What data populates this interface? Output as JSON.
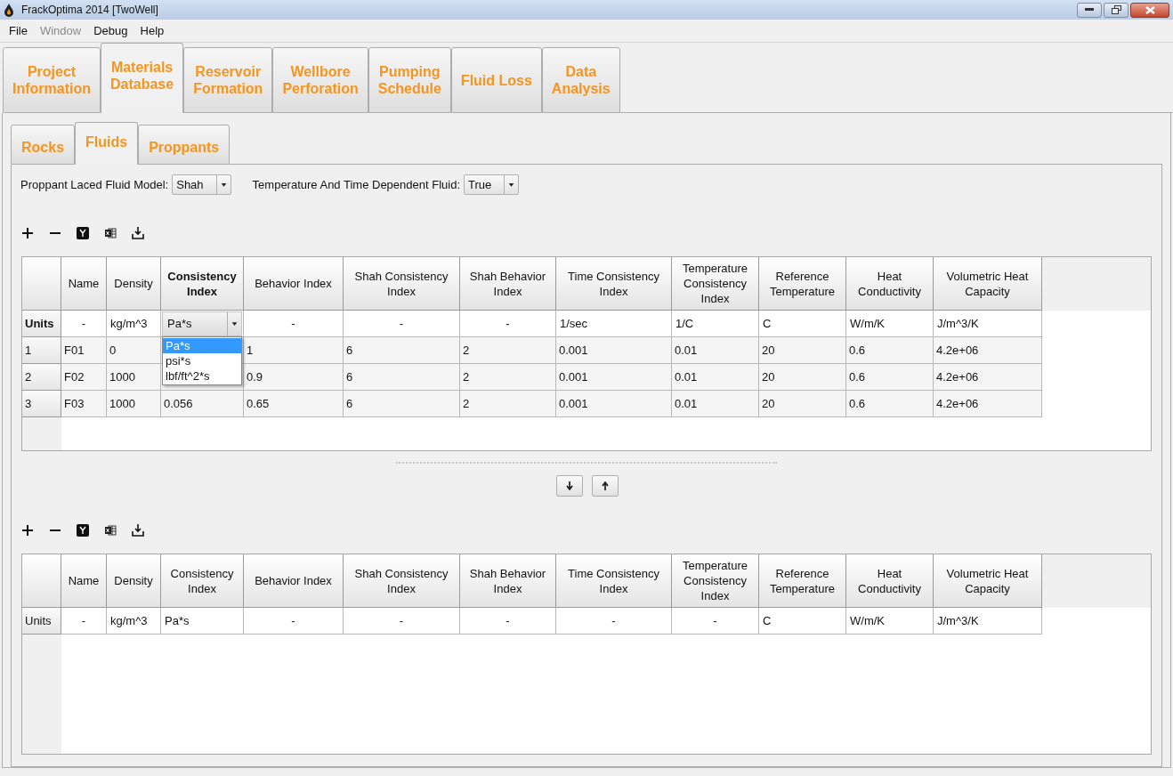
{
  "window": {
    "title": "FrackOptima 2014 [TwoWell]"
  },
  "menu": [
    {
      "label": "File",
      "disabled": false
    },
    {
      "label": "Window",
      "disabled": true
    },
    {
      "label": "Debug",
      "disabled": false
    },
    {
      "label": "Help",
      "disabled": false
    }
  ],
  "main_tabs": [
    {
      "label": "Project\nInformation",
      "selected": false
    },
    {
      "label": "Materials\nDatabase",
      "selected": true
    },
    {
      "label": "Reservoir\nFormation",
      "selected": false
    },
    {
      "label": "Wellbore\nPerforation",
      "selected": false
    },
    {
      "label": "Pumping\nSchedule",
      "selected": false
    },
    {
      "label": "Fluid Loss",
      "selected": false
    },
    {
      "label": "Data\nAnalysis",
      "selected": false
    }
  ],
  "sub_tabs": [
    {
      "label": "Rocks",
      "selected": false
    },
    {
      "label": "Fluids",
      "selected": true
    },
    {
      "label": "Proppants",
      "selected": false
    }
  ],
  "settings": [
    {
      "label": "Proppant Laced Fluid Model:",
      "value": "Shah"
    },
    {
      "label": "Temperature And Time Dependent Fluid:",
      "value": "True"
    }
  ],
  "tables": [
    {
      "columns": [
        {
          "label": "Name",
          "selected": false
        },
        {
          "label": "Density",
          "selected": false
        },
        {
          "label": "Consistency Index",
          "selected": true
        },
        {
          "label": "Behavior Index",
          "selected": false
        },
        {
          "label": "Shah Consistency Index",
          "selected": false
        },
        {
          "label": "Shah Behavior Index",
          "selected": false
        },
        {
          "label": "Time Consistency Index",
          "selected": false
        },
        {
          "label": "Temperature Consistency Index",
          "selected": false
        },
        {
          "label": "Reference Temperature",
          "selected": false
        },
        {
          "label": "Heat Conductivity",
          "selected": false
        },
        {
          "label": "Volumetric Heat Capacity",
          "selected": false
        }
      ],
      "units": {
        "label": "Units",
        "selected": true,
        "cells": [
          {
            "kind": "na",
            "text": "-"
          },
          {
            "kind": "text",
            "text": "kg/m^3"
          },
          {
            "kind": "dropdown",
            "text": "Pa*s",
            "open": true,
            "options": [
              {
                "label": "Pa*s",
                "selected": true
              },
              {
                "label": "psi*s",
                "selected": false
              },
              {
                "label": "lbf/ft^2*s",
                "selected": false
              }
            ]
          },
          {
            "kind": "na",
            "text": "-"
          },
          {
            "kind": "na",
            "text": "-"
          },
          {
            "kind": "na",
            "text": "-"
          },
          {
            "kind": "text",
            "text": "1/sec"
          },
          {
            "kind": "text",
            "text": "1/C"
          },
          {
            "kind": "text",
            "text": "C"
          },
          {
            "kind": "text",
            "text": "W/m/K"
          },
          {
            "kind": "text",
            "text": "J/m^3/K"
          }
        ]
      },
      "rows": [
        {
          "label": "1",
          "cells": [
            "F01",
            "0",
            null,
            "1",
            "6",
            "2",
            "0.001",
            "0.01",
            "20",
            "0.6",
            "4.2e+06"
          ]
        },
        {
          "label": "2",
          "cells": [
            "F02",
            "1000",
            null,
            "0.9",
            "6",
            "2",
            "0.001",
            "0.01",
            "20",
            "0.6",
            "4.2e+06"
          ]
        },
        {
          "label": "3",
          "cells": [
            "F03",
            "1000",
            "0.056",
            "0.65",
            "6",
            "2",
            "0.001",
            "0.01",
            "20",
            "0.6",
            "4.2e+06"
          ]
        }
      ]
    },
    {
      "columns": [
        {
          "label": "Name",
          "selected": false
        },
        {
          "label": "Density",
          "selected": false
        },
        {
          "label": "Consistency Index",
          "selected": false
        },
        {
          "label": "Behavior Index",
          "selected": false
        },
        {
          "label": "Shah Consistency Index",
          "selected": false
        },
        {
          "label": "Shah Behavior Index",
          "selected": false
        },
        {
          "label": "Time Consistency Index",
          "selected": false
        },
        {
          "label": "Temperature Consistency Index",
          "selected": false
        },
        {
          "label": "Reference Temperature",
          "selected": false
        },
        {
          "label": "Heat Conductivity",
          "selected": false
        },
        {
          "label": "Volumetric Heat Capacity",
          "selected": false
        }
      ],
      "units": {
        "label": "Units",
        "selected": false,
        "cells": [
          {
            "kind": "na",
            "text": "-"
          },
          {
            "kind": "text",
            "text": "kg/m^3"
          },
          {
            "kind": "text",
            "text": "Pa*s"
          },
          {
            "kind": "na",
            "text": "-"
          },
          {
            "kind": "na",
            "text": "-"
          },
          {
            "kind": "na",
            "text": "-"
          },
          {
            "kind": "na",
            "text": "-"
          },
          {
            "kind": "na",
            "text": "-"
          },
          {
            "kind": "text",
            "text": "C"
          },
          {
            "kind": "text",
            "text": "W/m/K"
          },
          {
            "kind": "text",
            "text": "J/m^3/K"
          }
        ]
      }
    }
  ]
}
